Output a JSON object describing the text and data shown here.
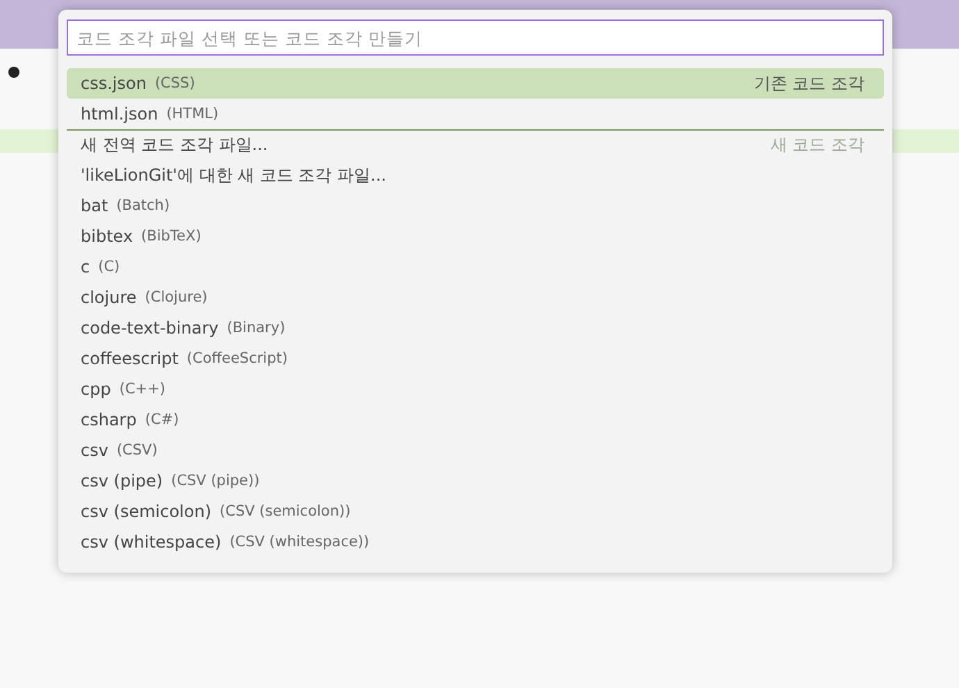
{
  "quick_pick": {
    "placeholder": "코드 조각 파일 선택 또는 코드 조각 만들기",
    "items": [
      {
        "label": "css.json",
        "description": "(CSS)",
        "group_label": "기존 코드 조각",
        "selected": true,
        "separator_before": false
      },
      {
        "label": "html.json",
        "description": "(HTML)",
        "selected": false,
        "separator_before": false
      },
      {
        "label": "새 전역 코드 조각 파일...",
        "group_label": "새 코드 조각",
        "selected": false,
        "separator_before": true
      },
      {
        "label": "'likeLionGit'에 대한 새 코드 조각 파일...",
        "selected": false,
        "separator_before": false
      },
      {
        "label": "bat",
        "description": "(Batch)",
        "selected": false,
        "separator_before": false
      },
      {
        "label": "bibtex",
        "description": "(BibTeX)",
        "selected": false,
        "separator_before": false
      },
      {
        "label": "c",
        "description": "(C)",
        "selected": false,
        "separator_before": false
      },
      {
        "label": "clojure",
        "description": "(Clojure)",
        "selected": false,
        "separator_before": false
      },
      {
        "label": "code-text-binary",
        "description": "(Binary)",
        "selected": false,
        "separator_before": false
      },
      {
        "label": "coffeescript",
        "description": "(CoffeeScript)",
        "selected": false,
        "separator_before": false
      },
      {
        "label": "cpp",
        "description": "(C++)",
        "selected": false,
        "separator_before": false
      },
      {
        "label": "csharp",
        "description": "(C#)",
        "selected": false,
        "separator_before": false
      },
      {
        "label": "csv",
        "description": "(CSV)",
        "selected": false,
        "separator_before": false
      },
      {
        "label": "csv (pipe)",
        "description": "(CSV (pipe))",
        "selected": false,
        "separator_before": false
      },
      {
        "label": "csv (semicolon)",
        "description": "(CSV (semicolon))",
        "selected": false,
        "separator_before": false
      },
      {
        "label": "csv (whitespace)",
        "description": "(CSV (whitespace))",
        "selected": false,
        "separator_before": false
      }
    ]
  }
}
